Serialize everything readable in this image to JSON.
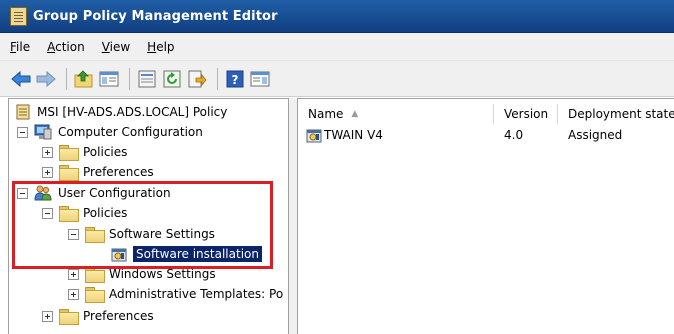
{
  "window": {
    "title": "Group Policy Management Editor"
  },
  "menu": [
    {
      "first": "F",
      "rest": "ile"
    },
    {
      "first": "A",
      "rest": "ction"
    },
    {
      "first": "V",
      "rest": "iew"
    },
    {
      "first": "H",
      "rest": "elp"
    }
  ],
  "toolbar": {
    "icons": [
      "back-arrow-icon",
      "forward-arrow-icon",
      "up-folder-icon",
      "show-hide-tree-icon",
      "properties-icon",
      "refresh-icon",
      "export-list-icon",
      "help-icon",
      "show-hide-action-pane-icon"
    ]
  },
  "tree": {
    "root": "MSI [HV-ADS.ADS.LOCAL] Policy",
    "computer_config": "Computer Configuration",
    "cc_policies": "Policies",
    "cc_preferences": "Preferences",
    "user_config": "User Configuration",
    "uc_policies": "Policies",
    "software_settings": "Software Settings",
    "software_installation": "Software installation",
    "windows_settings": "Windows Settings",
    "admin_templates": "Administrative Templates: Po",
    "uc_preferences": "Preferences"
  },
  "list": {
    "columns": {
      "name": "Name",
      "sort_indicator": "▲",
      "version": "Version",
      "deployment_state": "Deployment state"
    },
    "rows": [
      {
        "name": "TWAIN V4",
        "version": "4.0",
        "deployment_state": "Assigned"
      }
    ]
  },
  "colors": {
    "titlebar": "#1a5299",
    "selection": "#0a246a",
    "highlight_box": "#d91f26"
  }
}
